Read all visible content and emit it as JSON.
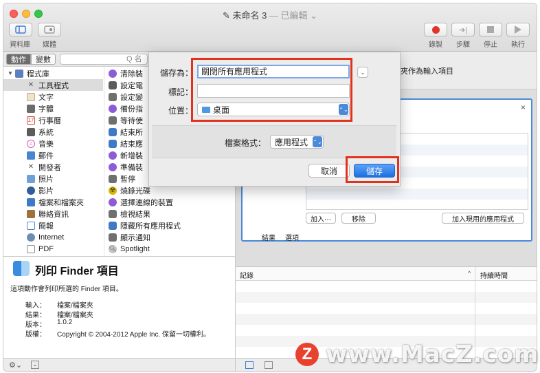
{
  "window": {
    "title": "未命名 3",
    "title_suffix": " — 已編輯 ⌄"
  },
  "toolbar": {
    "left": [
      {
        "label": "資料庫",
        "icon": "library-icon"
      },
      {
        "label": "媒體",
        "icon": "media-icon"
      }
    ],
    "right": [
      {
        "label": "錄製",
        "icon": "record-icon"
      },
      {
        "label": "步驟",
        "icon": "step-icon"
      },
      {
        "label": "停止",
        "icon": "stop-icon"
      },
      {
        "label": "執行",
        "icon": "run-icon"
      }
    ]
  },
  "library": {
    "tab_actions": "動作",
    "tab_variables": "變數",
    "search_placeholder": "Q 名",
    "categories": [
      {
        "label": "程式庫",
        "icon": "library-folder-icon",
        "color": "#5b7fbf"
      },
      {
        "label": "工具程式",
        "icon": "utilities-icon",
        "color": "#7a7a7a"
      },
      {
        "label": "文字",
        "icon": "text-icon",
        "color": "#a37b4a"
      },
      {
        "label": "字體",
        "icon": "fonts-icon",
        "color": "#6b6b6b"
      },
      {
        "label": "行事曆",
        "icon": "calendar-icon",
        "color": "#d7463d"
      },
      {
        "label": "系統",
        "icon": "system-icon",
        "color": "#5c5c5c"
      },
      {
        "label": "音樂",
        "icon": "music-icon",
        "color": "#d85ab5"
      },
      {
        "label": "郵件",
        "icon": "mail-icon",
        "color": "#4a86cf"
      },
      {
        "label": "開發者",
        "icon": "developer-icon",
        "color": "#6f6f6f"
      },
      {
        "label": "照片",
        "icon": "photos-icon",
        "color": "#6ea2d6"
      },
      {
        "label": "影片",
        "icon": "movies-icon",
        "color": "#2f5e99"
      },
      {
        "label": "檔案和檔案夾",
        "icon": "files-folders-icon",
        "color": "#3e7bc4"
      },
      {
        "label": "聯絡資訊",
        "icon": "contacts-icon",
        "color": "#a0713a"
      },
      {
        "label": "簡報",
        "icon": "presentations-icon",
        "color": "#4a89d4"
      },
      {
        "label": "Internet",
        "icon": "internet-icon",
        "color": "#6d8db1"
      },
      {
        "label": "PDF",
        "icon": "pdf-icon",
        "color": "#8a8a8a"
      }
    ],
    "actions": [
      {
        "label": "清除裝",
        "icon": "action-purple-icon",
        "color": "#8e5bd6"
      },
      {
        "label": "設定電",
        "icon": "action-system-icon",
        "color": "#5c5c5c"
      },
      {
        "label": "設定變",
        "icon": "action-automator-icon",
        "color": "#6f6f6f"
      },
      {
        "label": "備份指",
        "icon": "action-purple-icon",
        "color": "#8e5bd6"
      },
      {
        "label": "等待使",
        "icon": "action-automator-icon",
        "color": "#6f6f6f"
      },
      {
        "label": "結束所",
        "icon": "action-finder-icon",
        "color": "#3e7bc4"
      },
      {
        "label": "結束應",
        "icon": "action-finder-icon",
        "color": "#3e7bc4"
      },
      {
        "label": "新增裝",
        "icon": "action-purple-icon",
        "color": "#8e5bd6"
      },
      {
        "label": "準備裝",
        "icon": "action-purple-icon",
        "color": "#8e5bd6"
      },
      {
        "label": "暫停",
        "icon": "action-automator-icon",
        "color": "#6f6f6f"
      },
      {
        "label": "燒錄光碟",
        "icon": "burn-icon",
        "color": "#d9b400"
      },
      {
        "label": "選擇連線的裝置",
        "icon": "action-purple-icon",
        "color": "#8e5bd6"
      },
      {
        "label": "檢視結果",
        "icon": "action-automator-icon",
        "color": "#6f6f6f"
      },
      {
        "label": "隱藏所有應用程式",
        "icon": "action-finder-icon",
        "color": "#3e7bc4"
      },
      {
        "label": "顯示通知",
        "icon": "action-automator-icon",
        "color": "#6f6f6f"
      },
      {
        "label": "Spotlight",
        "icon": "spotlight-icon",
        "color": "#9a9a9a"
      }
    ]
  },
  "description": {
    "title": "列印 Finder 項目",
    "summary": "這項動作會列印所選的 Finder 項目。",
    "input_label": "輸入：",
    "input_value": "檔案/檔案夾",
    "result_label": "結果：",
    "result_value": "檔案/檔案夾",
    "version_label": "版本：",
    "version_value": "1.0.2",
    "copyright_label": "版權：",
    "copyright_value": "Copyright © 2004-2012 Apple Inc. 保留一切權利。"
  },
  "workflow": {
    "header_text": "夾作為輸入項目",
    "card": {
      "add_button": "加入⋯",
      "remove_button": "移除",
      "add_current_button": "加入現用的應用程式",
      "results_tab": "結果",
      "options_tab": "選項"
    }
  },
  "log": {
    "column_log": "記錄",
    "column_duration": "持續時間"
  },
  "save_sheet": {
    "save_as_label": "儲存為：",
    "save_as_value": "關閉所有應用程式",
    "tags_label": "標記：",
    "tags_value": "",
    "where_label": "位置：",
    "where_value": "桌面",
    "format_label": "檔案格式：",
    "format_value": "應用程式",
    "cancel_button": "取消",
    "save_button": "儲存"
  },
  "watermark": {
    "logo_letter": "Z",
    "text": "www.MacZ.com"
  },
  "colors": {
    "highlight_red": "#e1321e",
    "accent_blue": "#4a8ad8"
  }
}
